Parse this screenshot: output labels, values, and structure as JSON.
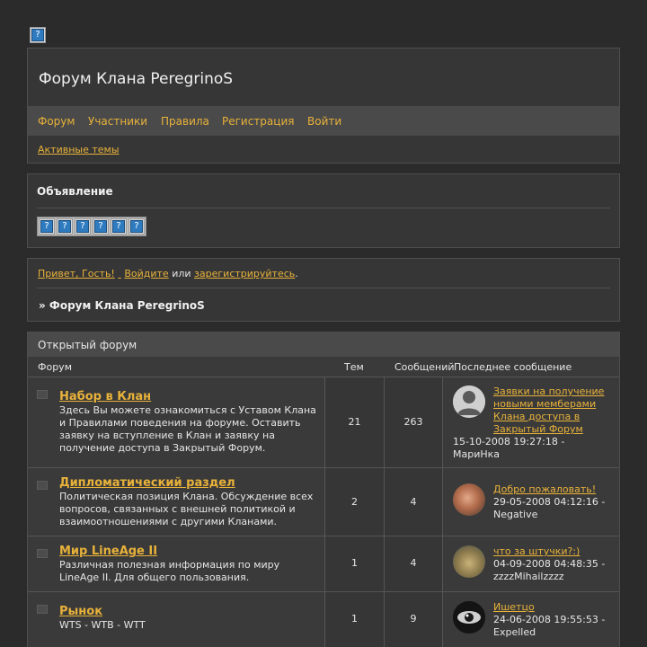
{
  "header": {
    "title": "Форум Клана PeregrinoS",
    "nav": [
      "Форум",
      "Участники",
      "Правила",
      "Регистрация",
      "Войти"
    ],
    "active_topics": "Активные темы"
  },
  "announcement": {
    "title": "Объявление"
  },
  "welcome": {
    "greeting": "Привет, Гость!",
    "login": "Войдите",
    "or": "или",
    "register": "зарегистрируйтесь",
    "period": ".",
    "breadcrumb": "» Форум Клана PeregrinoS"
  },
  "category": {
    "title": "Открытый форум",
    "columns": {
      "forum": "Форум",
      "topics": "Тем",
      "posts": "Сообщений",
      "last": "Последнее сообщение"
    },
    "forums": [
      {
        "name": "Набор в Клан",
        "desc": "Здесь Вы можете ознакомиться с Уставом Клана и Правилами поведения на форуме. Оставить заявку на вступление в Клан и заявку на получение доступа в Закрытый Форум.",
        "topics": "21",
        "posts": "263",
        "last_topic": "Заявки на получение новыми мемберами Клана доступа в Закрытый Форум",
        "last_date": "15-10-2008 19:27:18 -",
        "last_author": "МариНка"
      },
      {
        "name": "Дипломатический раздел",
        "desc": "Политическая позиция Клана. Обсуждение всех вопросов, связанных с внешней политикой и взаимоотношениями с другими Кланами.",
        "topics": "2",
        "posts": "4",
        "last_topic": "Добро пожаловать!",
        "last_date": "29-05-2008 04:12:16 -",
        "last_author": "Negative"
      },
      {
        "name": "Мир LineAge II",
        "desc": "Различная полезная информация по миру LineAge II. Для общего пользования.",
        "topics": "1",
        "posts": "4",
        "last_topic": "что за штучки?:)",
        "last_date": "04-09-2008 04:48:35 -",
        "last_author": "zzzzMihailzzzz"
      },
      {
        "name": "Рынок",
        "desc": "WTS - WTB - WTT",
        "topics": "1",
        "posts": "9",
        "last_topic": "Ишетцо",
        "last_date": "24-06-2008 19:55:53 -",
        "last_author": "Expelled"
      }
    ]
  }
}
